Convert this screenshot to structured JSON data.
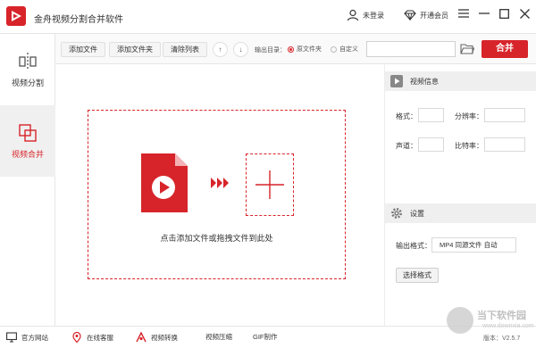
{
  "window": {
    "title": "金舟视频分割合并软件",
    "login_label": "未登录",
    "vip_label": "开通会员"
  },
  "sidebar": {
    "items": [
      {
        "label": "视频分割",
        "active": false
      },
      {
        "label": "视频合并",
        "active": true
      }
    ]
  },
  "toolbar": {
    "add_file": "添加文件",
    "add_folder": "添加文件夹",
    "clear_list": "清除列表",
    "output_label": "输出目录：",
    "radio_source": "原文件夹",
    "radio_custom": "自定义",
    "path_value": "",
    "merge_label": "合并"
  },
  "drop_zone": {
    "hint": "点击添加文件或拖拽文件到此处"
  },
  "info_panel": {
    "title": "视频信息",
    "format_label": "格式：",
    "resolution_label": "分辨率：",
    "channel_label": "声道：",
    "bitrate_label": "比特率："
  },
  "settings_panel": {
    "title": "设置",
    "output_format_label": "输出格式：",
    "output_format_value": "MP4 同源文件 自动",
    "select_format_button": "选择格式"
  },
  "footer": {
    "website": "官方网站",
    "support": "在线客服",
    "convert": "视频转换",
    "compress": "视频压缩",
    "gif": "GIF制作",
    "version": "版本：V2.5.7"
  },
  "watermark": {
    "text": "当下软件园",
    "url": "www.downxia.com"
  },
  "colors": {
    "accent": "#d7242a",
    "panel_header": "#efefef"
  }
}
